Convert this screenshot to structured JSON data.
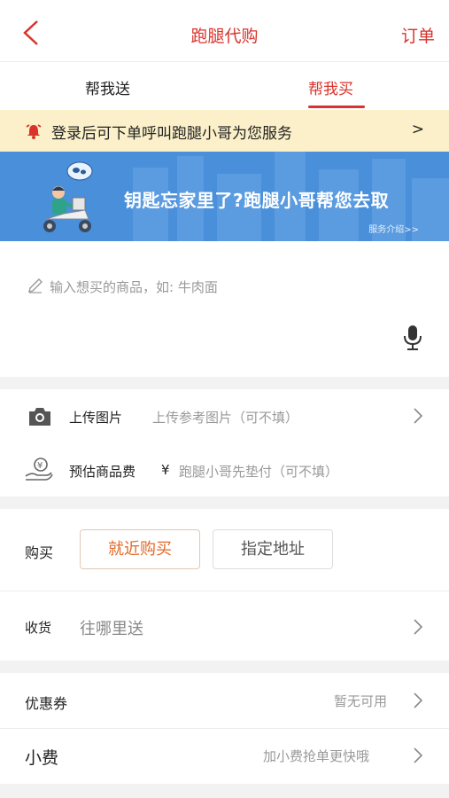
{
  "header": {
    "title": "跑腿代购",
    "order_label": "订单"
  },
  "tabs": [
    {
      "label": "帮我送",
      "active": false
    },
    {
      "label": "帮我买",
      "active": true
    }
  ],
  "notice": {
    "text": "登录后可下单呼叫跑腿小哥为您服务",
    "arrow": ">"
  },
  "banner": {
    "headline": "钥匙忘家里了?跑腿小哥帮您去取",
    "link": "服务介绍>>"
  },
  "goods": {
    "placeholder": "输入想买的商品，如: 牛肉面"
  },
  "upload": {
    "label": "上传图片",
    "hint": "上传参考图片（可不填）"
  },
  "estimate": {
    "label": "预估商品费",
    "currency": "¥",
    "hint": "跑腿小哥先垫付（可不填）"
  },
  "buy": {
    "label": "购买",
    "options": [
      "就近购买",
      "指定地址"
    ]
  },
  "receive": {
    "label": "收货",
    "placeholder": "往哪里送"
  },
  "coupon": {
    "label": "优惠券",
    "value": "暂无可用"
  },
  "tip": {
    "label": "小费",
    "value": "加小费抢单更快哦"
  },
  "colors": {
    "accent": "#d8332c",
    "banner": "#4a8fd9",
    "notice_bg": "#fbf0c9",
    "active_option": "#e06a2b"
  }
}
